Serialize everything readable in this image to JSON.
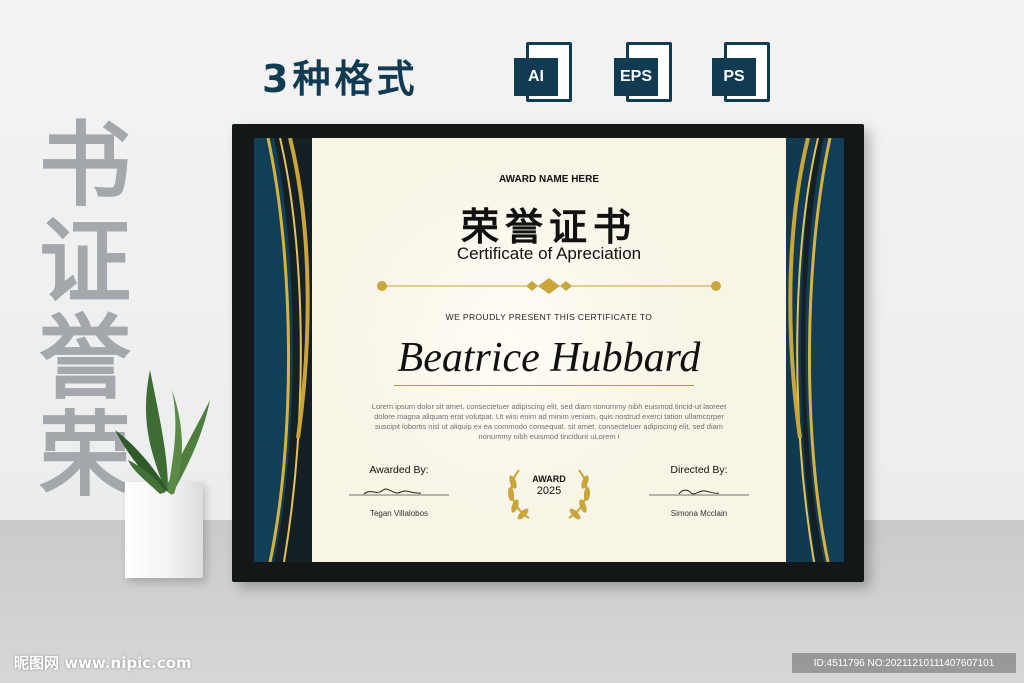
{
  "header": {
    "title": "3种格式",
    "formats": [
      {
        "label": "AI",
        "icon": "ai-file-icon"
      },
      {
        "label": "EPS",
        "icon": "eps-file-icon"
      },
      {
        "label": "PS",
        "icon": "ps-file-icon"
      }
    ]
  },
  "vertical_text": [
    "书",
    "证",
    "誉",
    "荣"
  ],
  "certificate": {
    "award_name": "AWARD NAME HERE",
    "title_cn": "荣誉证书",
    "title_en": "Certificate of Apreciation",
    "present_text": "WE PROUDLY PRESENT THIS CERTIFICATE TO",
    "recipient": "Beatrice Hubbard",
    "body": "Lorem ipsum dolor sit amet, consectetuer adipiscing elit, sed diam nonummy nibh euismod tincid-ut laoreet dolore magna aliquam erat volutpat. Ut wisi enim ad minim veniam, quis nostrud exerci tation ullamcorper suscipit lobortis nisl ut aliquip ex ea commodo consequat. sit amet, consectetuer adipiscing elit, sed diam nonummy nibh euismod tincidunt uLorem i",
    "left_sig": {
      "label": "Awarded By:",
      "name": "Tegan Villalobos"
    },
    "right_sig": {
      "label": "Directed By:",
      "name": "Simona Mcclain"
    },
    "seal": {
      "line1": "AWARD",
      "line2": "2025"
    }
  },
  "colors": {
    "navy": "#113b52",
    "gold": "#c9a53a",
    "frame": "#141718",
    "paper": "#f8f4e6"
  },
  "watermark": {
    "left": "昵图网 www.nipic.com",
    "right": "ID:4511796 NO:20211210111407607101"
  }
}
